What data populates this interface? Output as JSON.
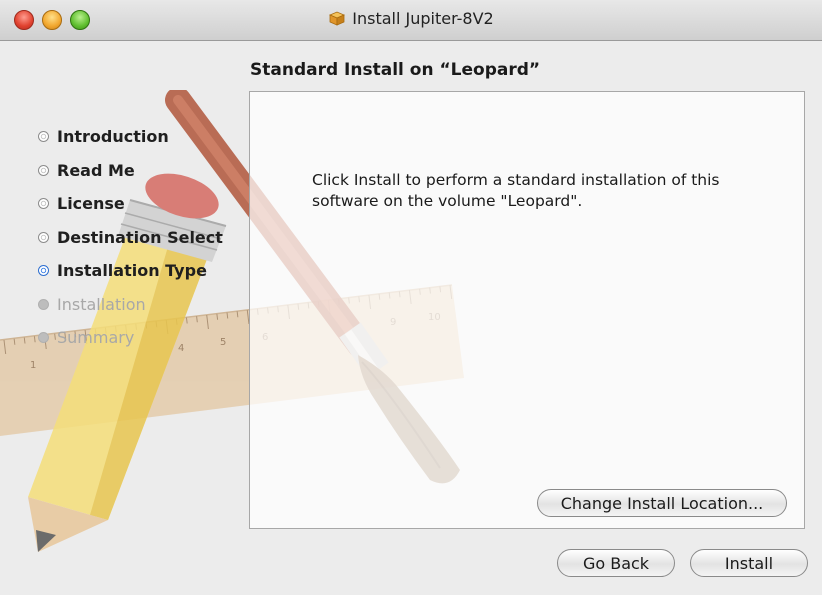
{
  "window": {
    "title": "Install Jupiter-8V2",
    "title_icon": "package-icon"
  },
  "heading": "Standard Install on “Leopard”",
  "steps": [
    {
      "label": "Introduction",
      "state": "done"
    },
    {
      "label": "Read Me",
      "state": "done"
    },
    {
      "label": "License",
      "state": "done"
    },
    {
      "label": "Destination Select",
      "state": "done"
    },
    {
      "label": "Installation Type",
      "state": "active"
    },
    {
      "label": "Installation",
      "state": "future"
    },
    {
      "label": "Summary",
      "state": "future"
    }
  ],
  "message": "Click Install to perform a standard installation of this software on the volume \"Leopard\".",
  "buttons": {
    "change_location": "Change Install Location...",
    "go_back": "Go Back",
    "install": "Install"
  },
  "ruler_numbers": [
    "1",
    "4",
    "5",
    "6",
    "9",
    "10"
  ],
  "colors": {
    "active_bullet": "#4a8ae8",
    "done_bullet": "#8c8c8c",
    "future_text": "#a8a8a8"
  }
}
